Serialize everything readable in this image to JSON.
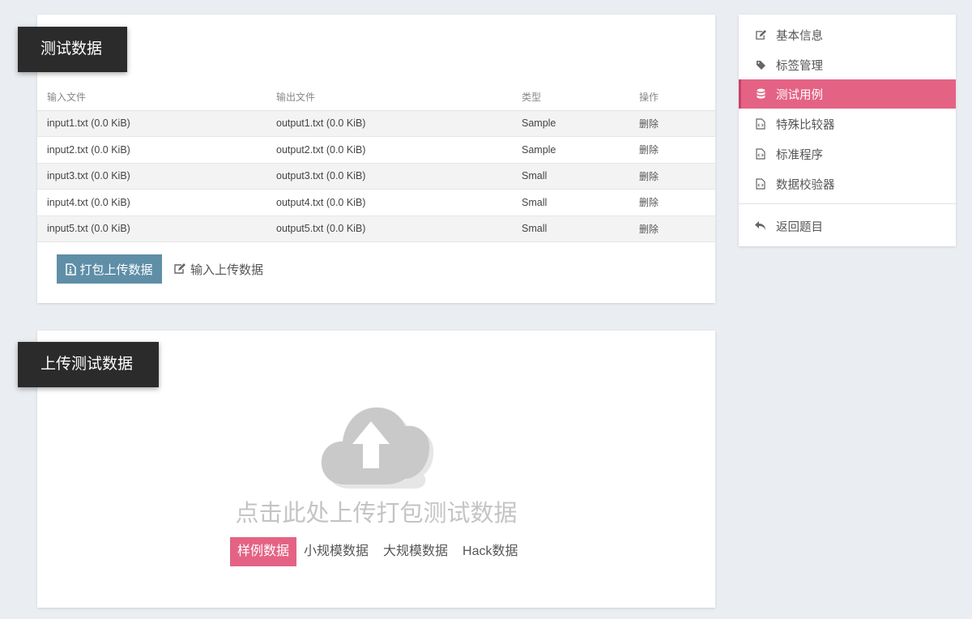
{
  "data_card": {
    "title": "测试数据",
    "columns": [
      "输入文件",
      "输出文件",
      "类型",
      "操作"
    ],
    "rows": [
      {
        "input": "input1.txt (0.0 KiB)",
        "output": "output1.txt (0.0 KiB)",
        "type": "Sample",
        "action": "删除"
      },
      {
        "input": "input2.txt (0.0 KiB)",
        "output": "output2.txt (0.0 KiB)",
        "type": "Sample",
        "action": "删除"
      },
      {
        "input": "input3.txt (0.0 KiB)",
        "output": "output3.txt (0.0 KiB)",
        "type": "Small",
        "action": "删除"
      },
      {
        "input": "input4.txt (0.0 KiB)",
        "output": "output4.txt (0.0 KiB)",
        "type": "Small",
        "action": "删除"
      },
      {
        "input": "input5.txt (0.0 KiB)",
        "output": "output5.txt (0.0 KiB)",
        "type": "Small",
        "action": "删除"
      }
    ],
    "pack_upload_label": "打包上传数据",
    "input_upload_label": "输入上传数据"
  },
  "upload_card": {
    "title": "上传测试数据",
    "prompt": "点击此处上传打包测试数据",
    "icon": "cloud-upload-icon",
    "types": [
      {
        "label": "样例数据",
        "active": true
      },
      {
        "label": "小规模数据",
        "active": false
      },
      {
        "label": "大规模数据",
        "active": false
      },
      {
        "label": "Hack数据",
        "active": false
      }
    ]
  },
  "sidebar": {
    "items": [
      {
        "label": "基本信息",
        "icon": "edit-icon"
      },
      {
        "label": "标签管理",
        "icon": "tag-icon"
      },
      {
        "label": "测试用例",
        "icon": "database-icon",
        "active": true
      },
      {
        "label": "特殊比较器",
        "icon": "code-file-icon"
      },
      {
        "label": "标准程序",
        "icon": "code-file-icon"
      },
      {
        "label": "数据校验器",
        "icon": "code-file-icon"
      }
    ],
    "back_label": "返回题目",
    "back_icon": "reply-icon"
  },
  "colors": {
    "accent": "#e46384",
    "pack_button": "#5f8ea7",
    "ribbon": "#2b2b2b",
    "background": "#eaedf1"
  }
}
